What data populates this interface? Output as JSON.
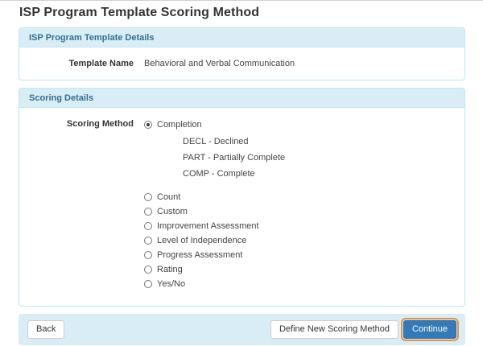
{
  "page": {
    "title": "ISP Program Template Scoring Method"
  },
  "template_details": {
    "heading": "ISP Program Template Details",
    "name_label": "Template Name",
    "name_value": "Behavioral and Verbal Communication"
  },
  "scoring": {
    "heading": "Scoring Details",
    "method_label": "Scoring Method",
    "selected_option": {
      "label": "Completion",
      "selected": true,
      "values": [
        "DECL - Declined",
        "PART - Partially Complete",
        "COMP - Complete"
      ]
    },
    "options": [
      "Count",
      "Custom",
      "Improvement Assessment",
      "Level of Independence",
      "Progress Assessment",
      "Rating",
      "Yes/No"
    ]
  },
  "actions": {
    "back": "Back",
    "define_new": "Define New Scoring Method",
    "continue": "Continue"
  },
  "colors": {
    "panel_heading_bg": "#d9edf7",
    "panel_heading_text": "#31708f",
    "panel_border": "#bce8f1",
    "action_bar_bg": "#d9edf7",
    "primary_button_bg": "#337ab7",
    "primary_button_border": "#2e6da4",
    "focus_outline": "#e8933c"
  }
}
